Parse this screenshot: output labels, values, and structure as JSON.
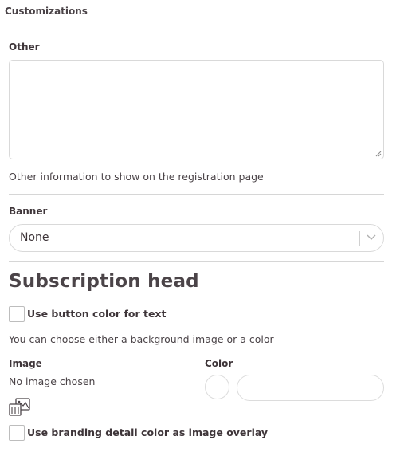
{
  "header": {
    "title": "Customizations"
  },
  "other": {
    "label": "Other",
    "value": "",
    "help": "Other information to show on the registration page"
  },
  "banner": {
    "label": "Banner",
    "selected": "None"
  },
  "subscription_head": {
    "heading": "Subscription head",
    "use_button_color_label": "Use button color for text",
    "use_button_color_checked": false,
    "help": "You can choose either a background image or a color",
    "image_label": "Image",
    "image_status": "No image chosen",
    "color_label": "Color",
    "color_value": "",
    "overlay_label": "Use branding detail color as image overlay",
    "overlay_checked": false
  }
}
